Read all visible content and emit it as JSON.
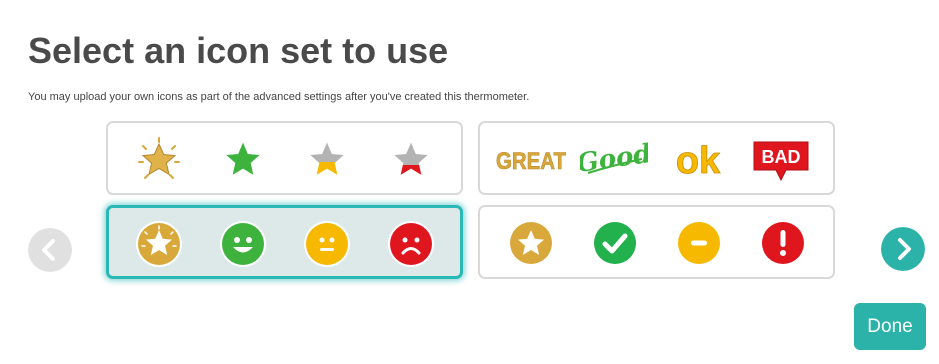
{
  "page": {
    "title": "Select an icon set to use",
    "subtitle": "You may upload your own icons as part of the advanced settings after you've created this thermometer."
  },
  "icon_sets": [
    {
      "name": "stars",
      "selected": false,
      "icons": [
        "gold-sparkle-star-icon",
        "green-star-icon",
        "half-yellow-star-icon",
        "half-red-star-icon"
      ]
    },
    {
      "name": "words",
      "selected": false,
      "icons": [
        "great-word-icon",
        "good-word-icon",
        "ok-word-icon",
        "bad-banner-icon"
      ],
      "labels": {
        "great": "GREAT",
        "good": "Good",
        "ok": "ok",
        "bad": "BAD"
      }
    },
    {
      "name": "faces",
      "selected": true,
      "icons": [
        "gold-star-badge-icon",
        "happy-face-icon",
        "neutral-face-icon",
        "sad-face-icon"
      ]
    },
    {
      "name": "symbols",
      "selected": false,
      "icons": [
        "gold-star-circle-icon",
        "green-check-icon",
        "yellow-minus-icon",
        "red-exclamation-icon"
      ]
    }
  ],
  "colors": {
    "gold": "#d9a83a",
    "green": "#3db33d",
    "yellow": "#f7b800",
    "red": "#e0161e",
    "teal": "#2bb3aa",
    "grey_nav": "#e0e0e0"
  },
  "nav": {
    "prev_icon": "chevron-left-icon",
    "next_icon": "chevron-right-icon"
  },
  "done_label": "Done"
}
